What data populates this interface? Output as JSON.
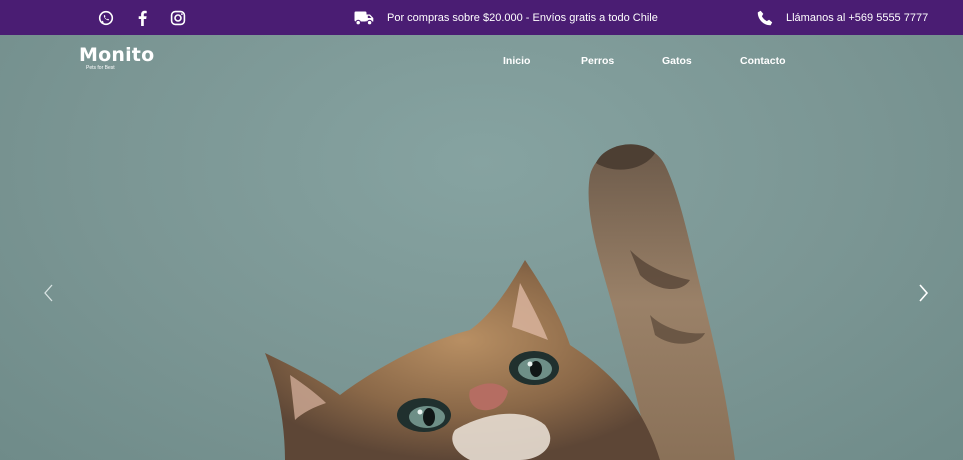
{
  "topbar": {
    "social": [
      "whatsapp-icon",
      "facebook-icon",
      "instagram-icon"
    ],
    "shipping_text": "Por compras sobre $20.000 - Envíos gratis a todo Chile",
    "phone_text": "Llámanos al +569 5555 7777"
  },
  "brand": {
    "name": "Monito",
    "tagline": "Pets for Best"
  },
  "nav": {
    "items": [
      "Inicio",
      "Perros",
      "Gatos",
      "Contacto"
    ]
  },
  "carousel": {
    "prev_icon": "chevron-left-icon",
    "next_icon": "chevron-right-icon"
  },
  "colors": {
    "topbar": "#4a1d73",
    "hero_bg": "#7e9a98"
  }
}
